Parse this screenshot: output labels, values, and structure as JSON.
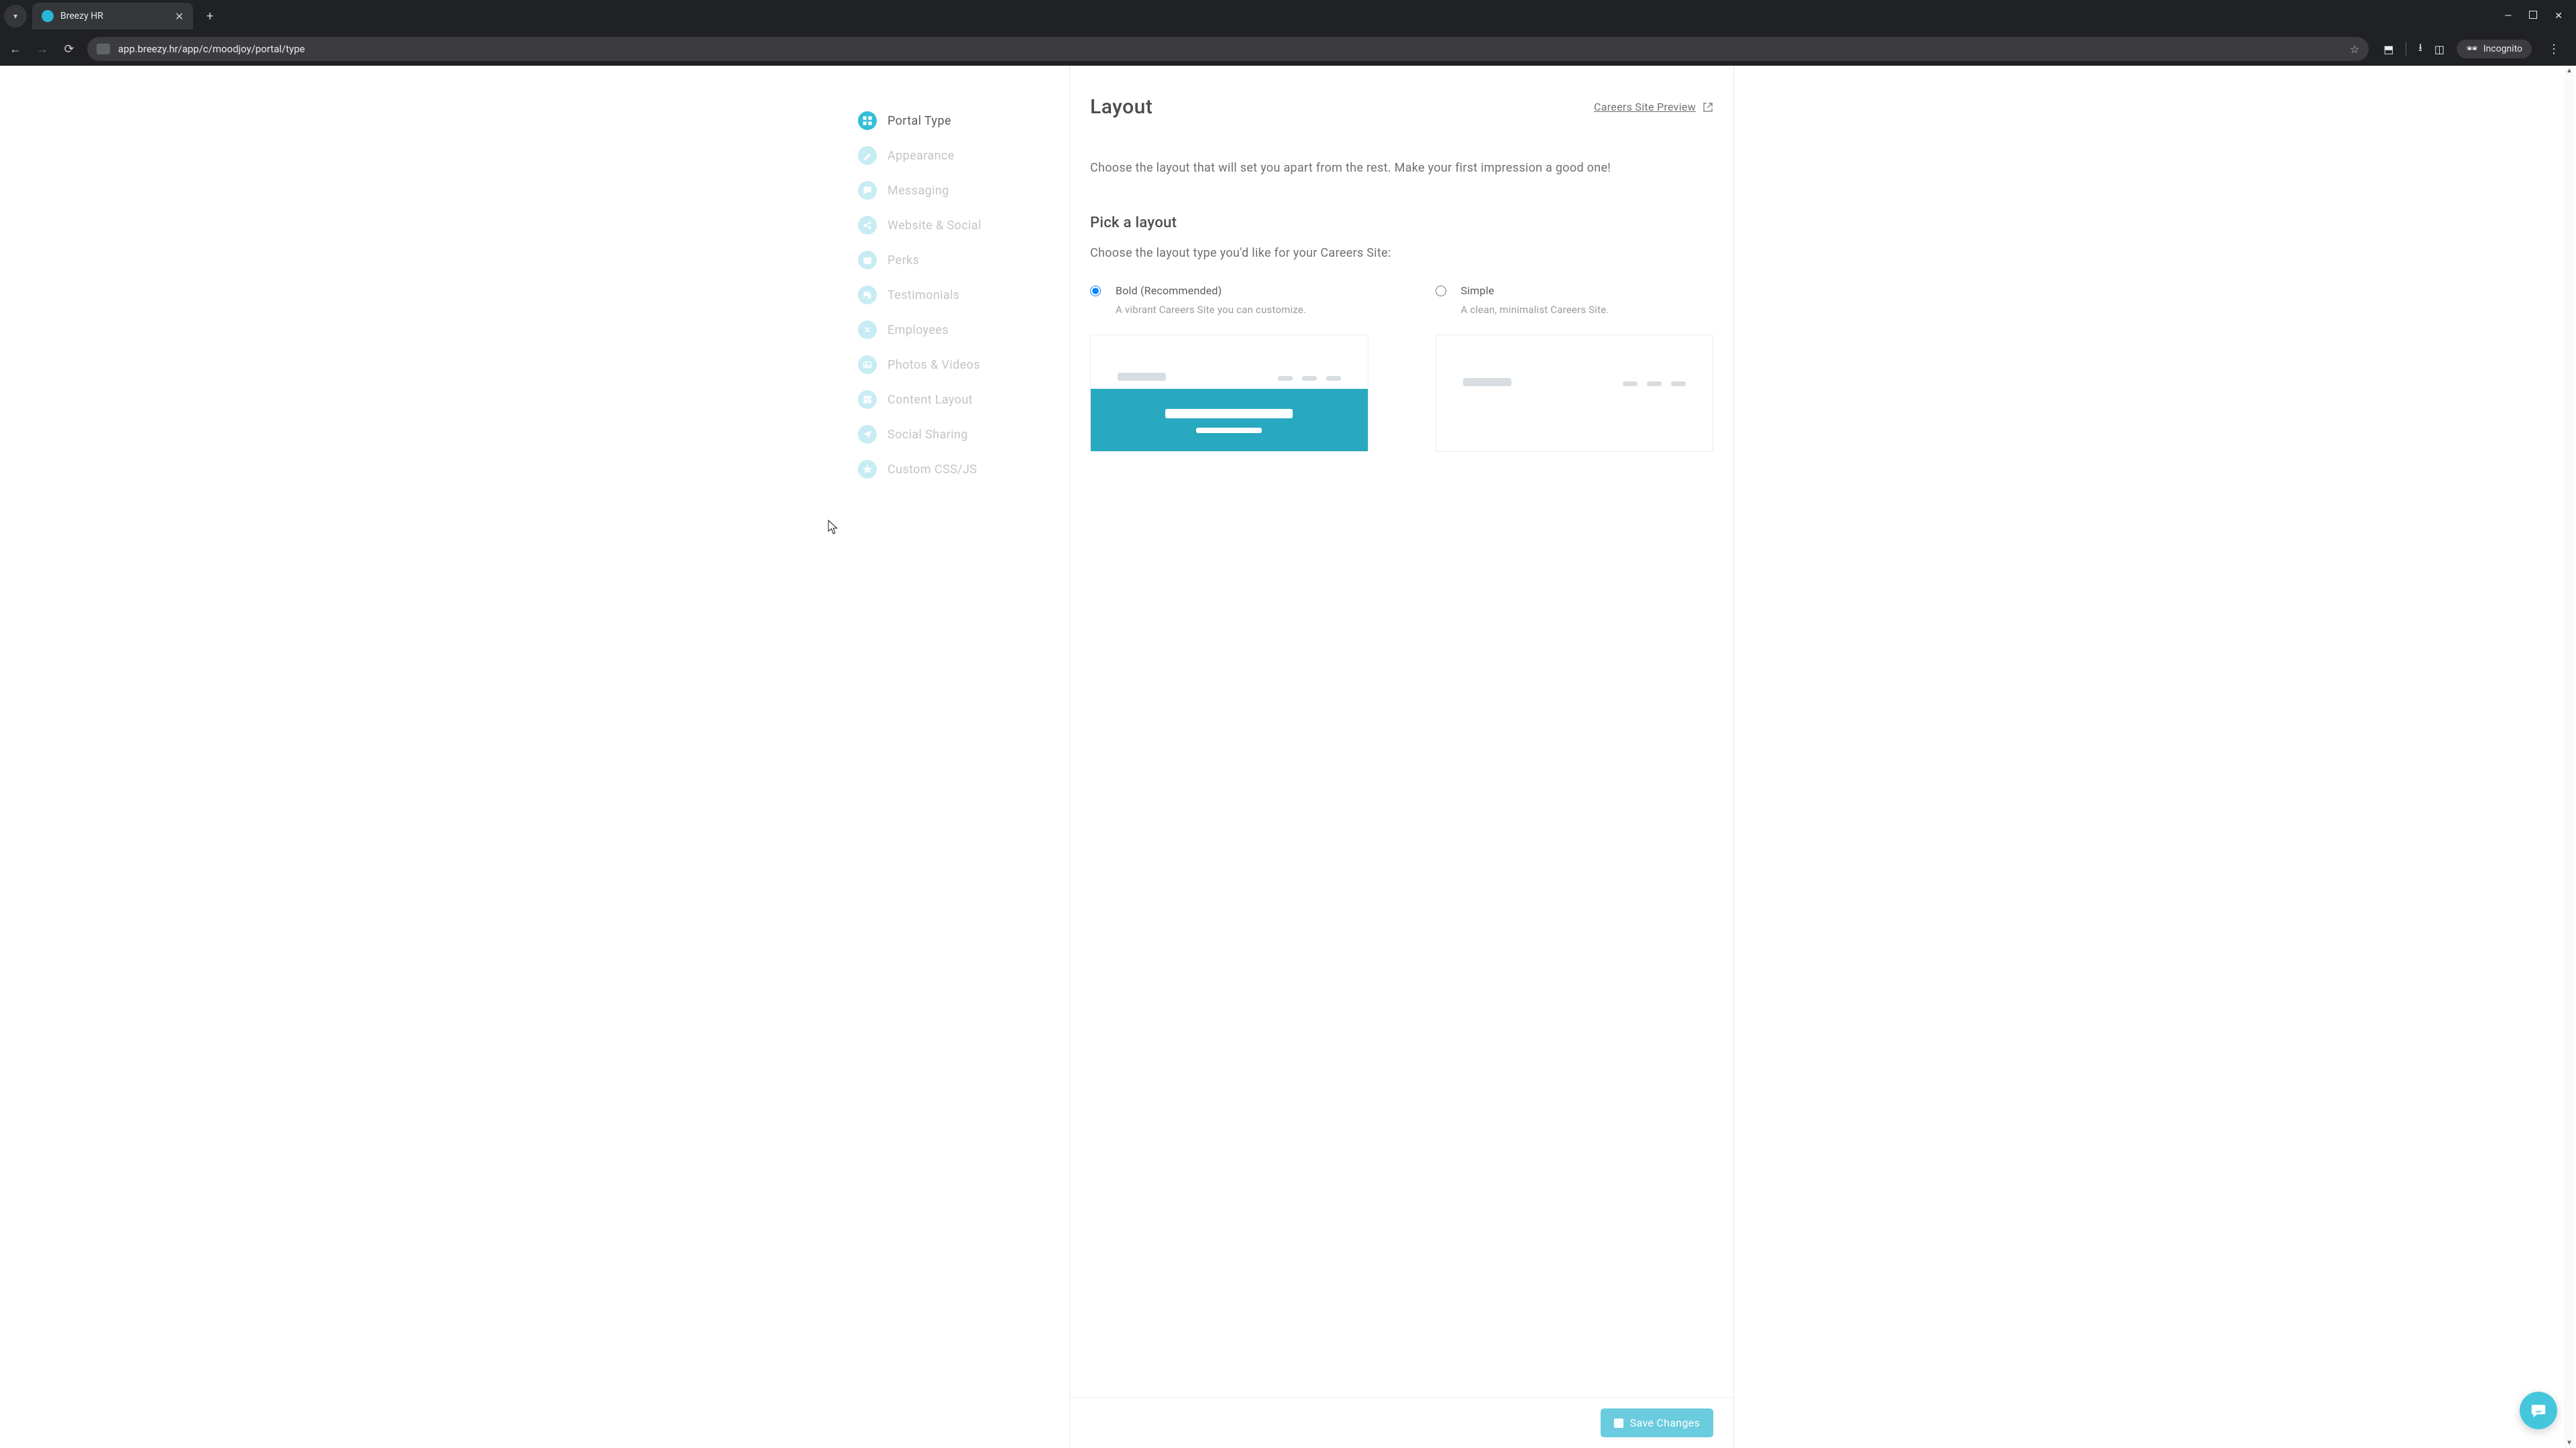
{
  "browser": {
    "tab_title": "Breezy HR",
    "url": "app.breezy.hr/app/c/moodjoy/portal/type",
    "incognito_label": "Incognito"
  },
  "sidebar": {
    "items": [
      {
        "key": "portal-type",
        "label": "Portal Type",
        "active": true,
        "icon": "grid"
      },
      {
        "key": "appearance",
        "label": "Appearance",
        "active": false,
        "icon": "brush"
      },
      {
        "key": "messaging",
        "label": "Messaging",
        "active": false,
        "icon": "message"
      },
      {
        "key": "website-social",
        "label": "Website & Social",
        "active": false,
        "icon": "share"
      },
      {
        "key": "perks",
        "label": "Perks",
        "active": false,
        "icon": "gift"
      },
      {
        "key": "testimonials",
        "label": "Testimonials",
        "active": false,
        "icon": "chat"
      },
      {
        "key": "employees",
        "label": "Employees",
        "active": false,
        "icon": "close"
      },
      {
        "key": "photos-videos",
        "label": "Photos & Videos",
        "active": false,
        "icon": "image"
      },
      {
        "key": "content-layout",
        "label": "Content Layout",
        "active": false,
        "icon": "layout"
      },
      {
        "key": "social-sharing",
        "label": "Social Sharing",
        "active": false,
        "icon": "send"
      },
      {
        "key": "custom-css-js",
        "label": "Custom CSS/JS",
        "active": false,
        "icon": "star"
      }
    ]
  },
  "main": {
    "title": "Layout",
    "preview_link": "Careers Site Preview",
    "description": "Choose the layout that will set you apart from the rest. Make your first impression a good one!",
    "section_title": "Pick a layout",
    "section_description": "Choose the layout type you'd like for your Careers Site:",
    "options": [
      {
        "key": "bold",
        "title": "Bold (Recommended)",
        "subtitle": "A vibrant Careers Site you can customize.",
        "selected": true
      },
      {
        "key": "simple",
        "title": "Simple",
        "subtitle": "A clean, minimalist Careers Site.",
        "selected": false
      }
    ],
    "save_label": "Save Changes"
  },
  "colors": {
    "accent": "#33bdd8",
    "accent_light": "#c7ecf3",
    "hero": "#29a9bf",
    "save_button": "#6accde"
  }
}
